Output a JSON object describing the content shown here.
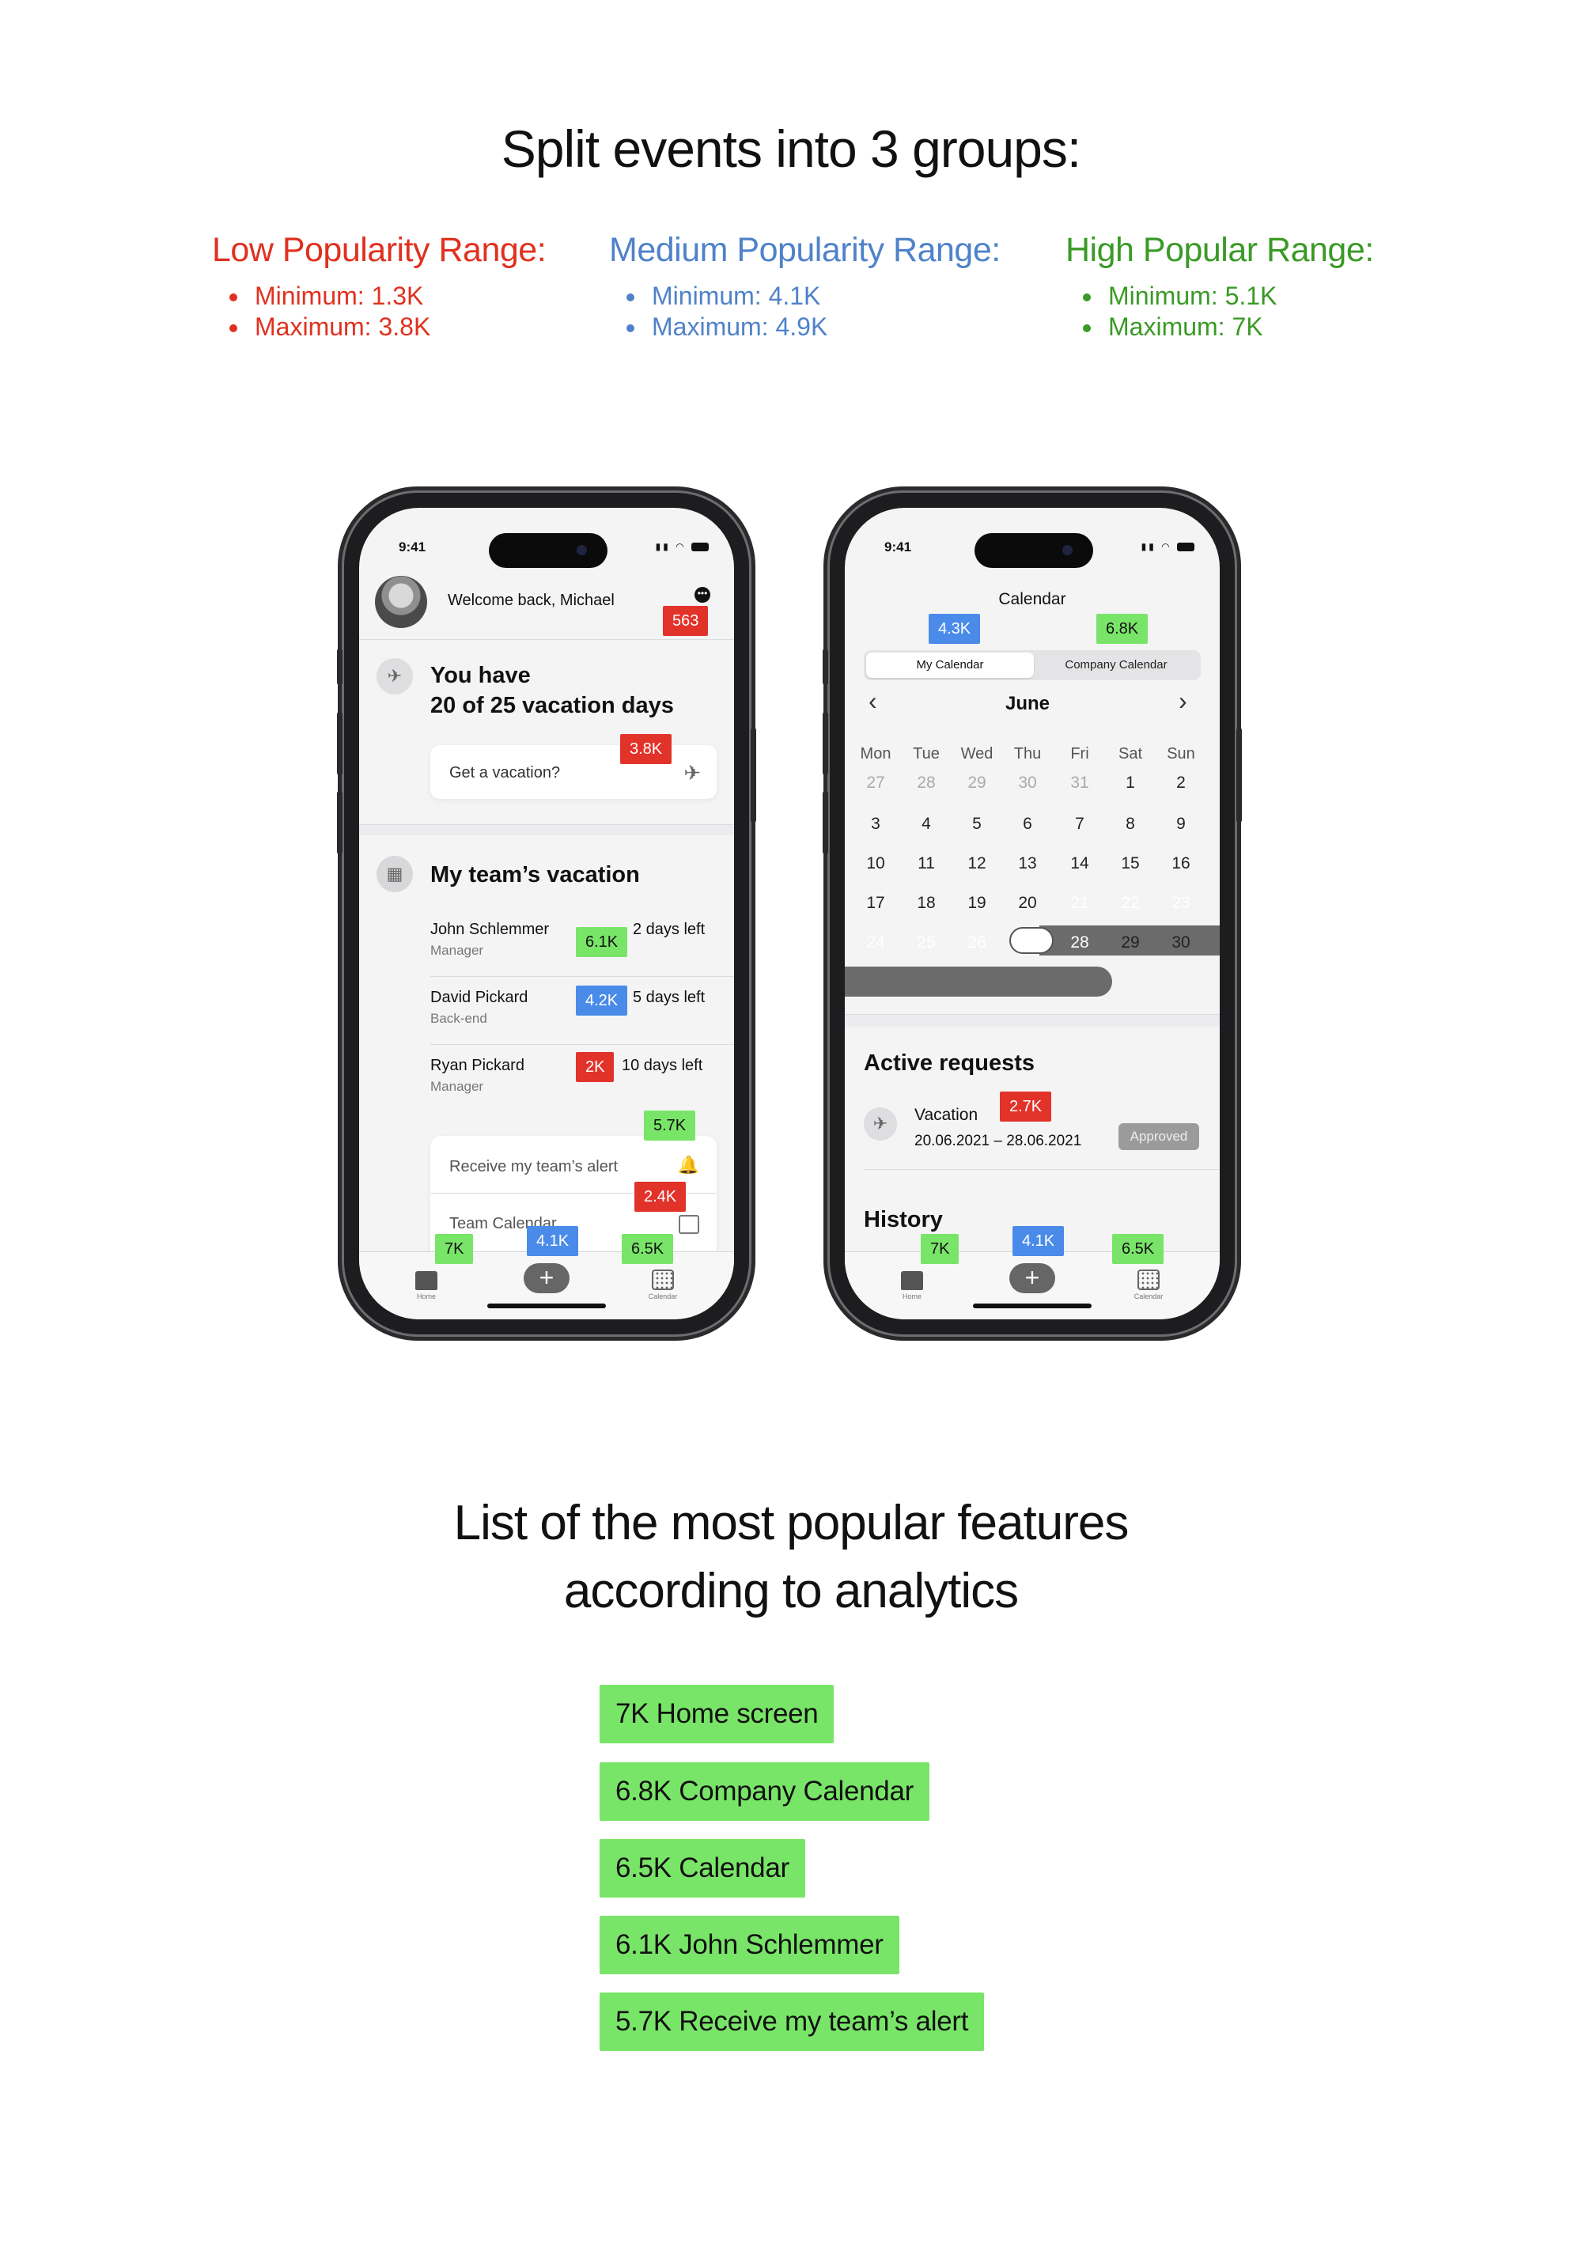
{
  "header": {
    "title": "Split events into 3 groups:"
  },
  "ranges": {
    "low": {
      "title": "Low Popularity Range:",
      "min": "Minimum: 1.3K",
      "max": "Maximum: 3.8K",
      "color": "#e0311f"
    },
    "medium": {
      "title": "Medium Popularity Range:",
      "min": "Minimum: 4.1K",
      "max": "Maximum: 4.9K",
      "color": "#4f82c9"
    },
    "high": {
      "title": "High Popular Range:",
      "min": "Minimum: 5.1K",
      "max": "Maximum: 7K",
      "color": "#3a9a26"
    }
  },
  "phone1": {
    "time": "9:41",
    "welcome": "Welcome back, Michael",
    "vacation_line1": "You have",
    "vacation_line2": "20 of 25 vacation days",
    "get_vacation": "Get a vacation?",
    "team_title": "My team’s vacation",
    "members": [
      {
        "name": "John Schlemmer",
        "role": "Manager",
        "days": "2 days left",
        "badge": "6.1K"
      },
      {
        "name": "David Pickard",
        "role": "Back-end",
        "days": "5 days left",
        "badge": "4.2K"
      },
      {
        "name": "Ryan Pickard",
        "role": "Manager",
        "days": "10 days left",
        "badge": "2K"
      }
    ],
    "receive_alert": "Receive my team’s alert",
    "team_calendar": "Team Calendar",
    "badges": {
      "welcome": "563",
      "get_vacation": "3.8K",
      "alert": "5.7K",
      "team_calendar": "2.4K",
      "home": "7K",
      "add": "4.1K",
      "calendar": "6.5K"
    },
    "tabs": {
      "home": "Home",
      "add": "+",
      "calendar": "Calendar"
    }
  },
  "phone2": {
    "time": "9:41",
    "title": "Calendar",
    "segments": {
      "my": "My Calendar",
      "company": "Company Calendar"
    },
    "month": "June",
    "prev": "‹",
    "next": "›",
    "weekdays": [
      "Mon",
      "Tue",
      "Wed",
      "Thu",
      "Fri",
      "Sat",
      "Sun"
    ],
    "weeks": [
      [
        "27",
        "28",
        "29",
        "30",
        "31",
        "1",
        "2"
      ],
      [
        "3",
        "4",
        "5",
        "6",
        "7",
        "8",
        "9"
      ],
      [
        "10",
        "11",
        "12",
        "13",
        "14",
        "15",
        "16"
      ],
      [
        "17",
        "18",
        "19",
        "20",
        "21",
        "22",
        "23"
      ],
      [
        "24",
        "25",
        "26",
        "27",
        "28",
        "29",
        "30"
      ]
    ],
    "selected_day": "20",
    "active_title": "Active requests",
    "request": {
      "type": "Vacation",
      "dates": "20.06.2021 – 28.06.2021",
      "status": "Approved"
    },
    "history_title": "History",
    "badges": {
      "my_calendar": "4.3K",
      "company_calendar": "6.8K",
      "request": "2.7K",
      "home": "7K",
      "add": "4.1K",
      "calendar": "6.5K"
    },
    "tabs": {
      "home": "Home",
      "add": "+",
      "calendar": "Calendar"
    }
  },
  "features": {
    "title_line1": "List of the most popular features",
    "title_line2": "according to analytics",
    "items": [
      "7K Home screen",
      "6.8K Company Calendar",
      "6.5K Calendar",
      "6.1K John Schlemmer",
      "5.7K Receive my team’s alert"
    ]
  },
  "colors": {
    "red_badge": "#e2332a",
    "blue_badge": "#4a8bea",
    "green_badge": "#79e568"
  }
}
